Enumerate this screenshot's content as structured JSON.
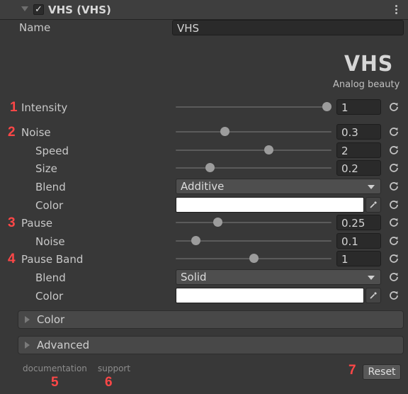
{
  "header": {
    "checked": "✓",
    "title": "VHS (VHS)"
  },
  "name_row": {
    "label": "Name",
    "value": "VHS"
  },
  "branding": {
    "logo": "VHS",
    "subtitle": "Analog beauty"
  },
  "rows": {
    "intensity": {
      "marker": "1",
      "label": "Intensity",
      "value": "1",
      "slider": 1.0
    },
    "noise": {
      "marker": "2",
      "label": "Noise",
      "value": "0.3",
      "slider": 0.3
    },
    "speed": {
      "label": "Speed",
      "value": "2",
      "slider": 0.6
    },
    "size": {
      "label": "Size",
      "value": "0.2",
      "slider": 0.2
    },
    "noise_blend": {
      "label": "Blend",
      "value": "Additive"
    },
    "noise_color": {
      "label": "Color",
      "value": "#ffffff"
    },
    "pause": {
      "marker": "3",
      "label": "Pause",
      "value": "0.25",
      "slider": 0.25
    },
    "pause_noise": {
      "label": "Noise",
      "value": "0.1",
      "slider": 0.1
    },
    "pause_band": {
      "marker": "4",
      "label": "Pause Band",
      "value": "1",
      "slider": 0.5
    },
    "band_blend": {
      "label": "Blend",
      "value": "Solid"
    },
    "band_color": {
      "label": "Color",
      "value": "#ffffff"
    }
  },
  "sections": {
    "color": "Color",
    "advanced": "Advanced"
  },
  "footer": {
    "documentation": "documentation",
    "doc_marker": "5",
    "support": "support",
    "support_marker": "6",
    "reset_marker": "7",
    "reset": "Reset"
  },
  "colors": {
    "marker": "#ff4747",
    "panel": "#383838",
    "field": "#2a2a2a"
  },
  "icons": {
    "reset": "refresh-icon",
    "picker": "eyedropper-icon",
    "menu": "kebab-menu-icon"
  }
}
